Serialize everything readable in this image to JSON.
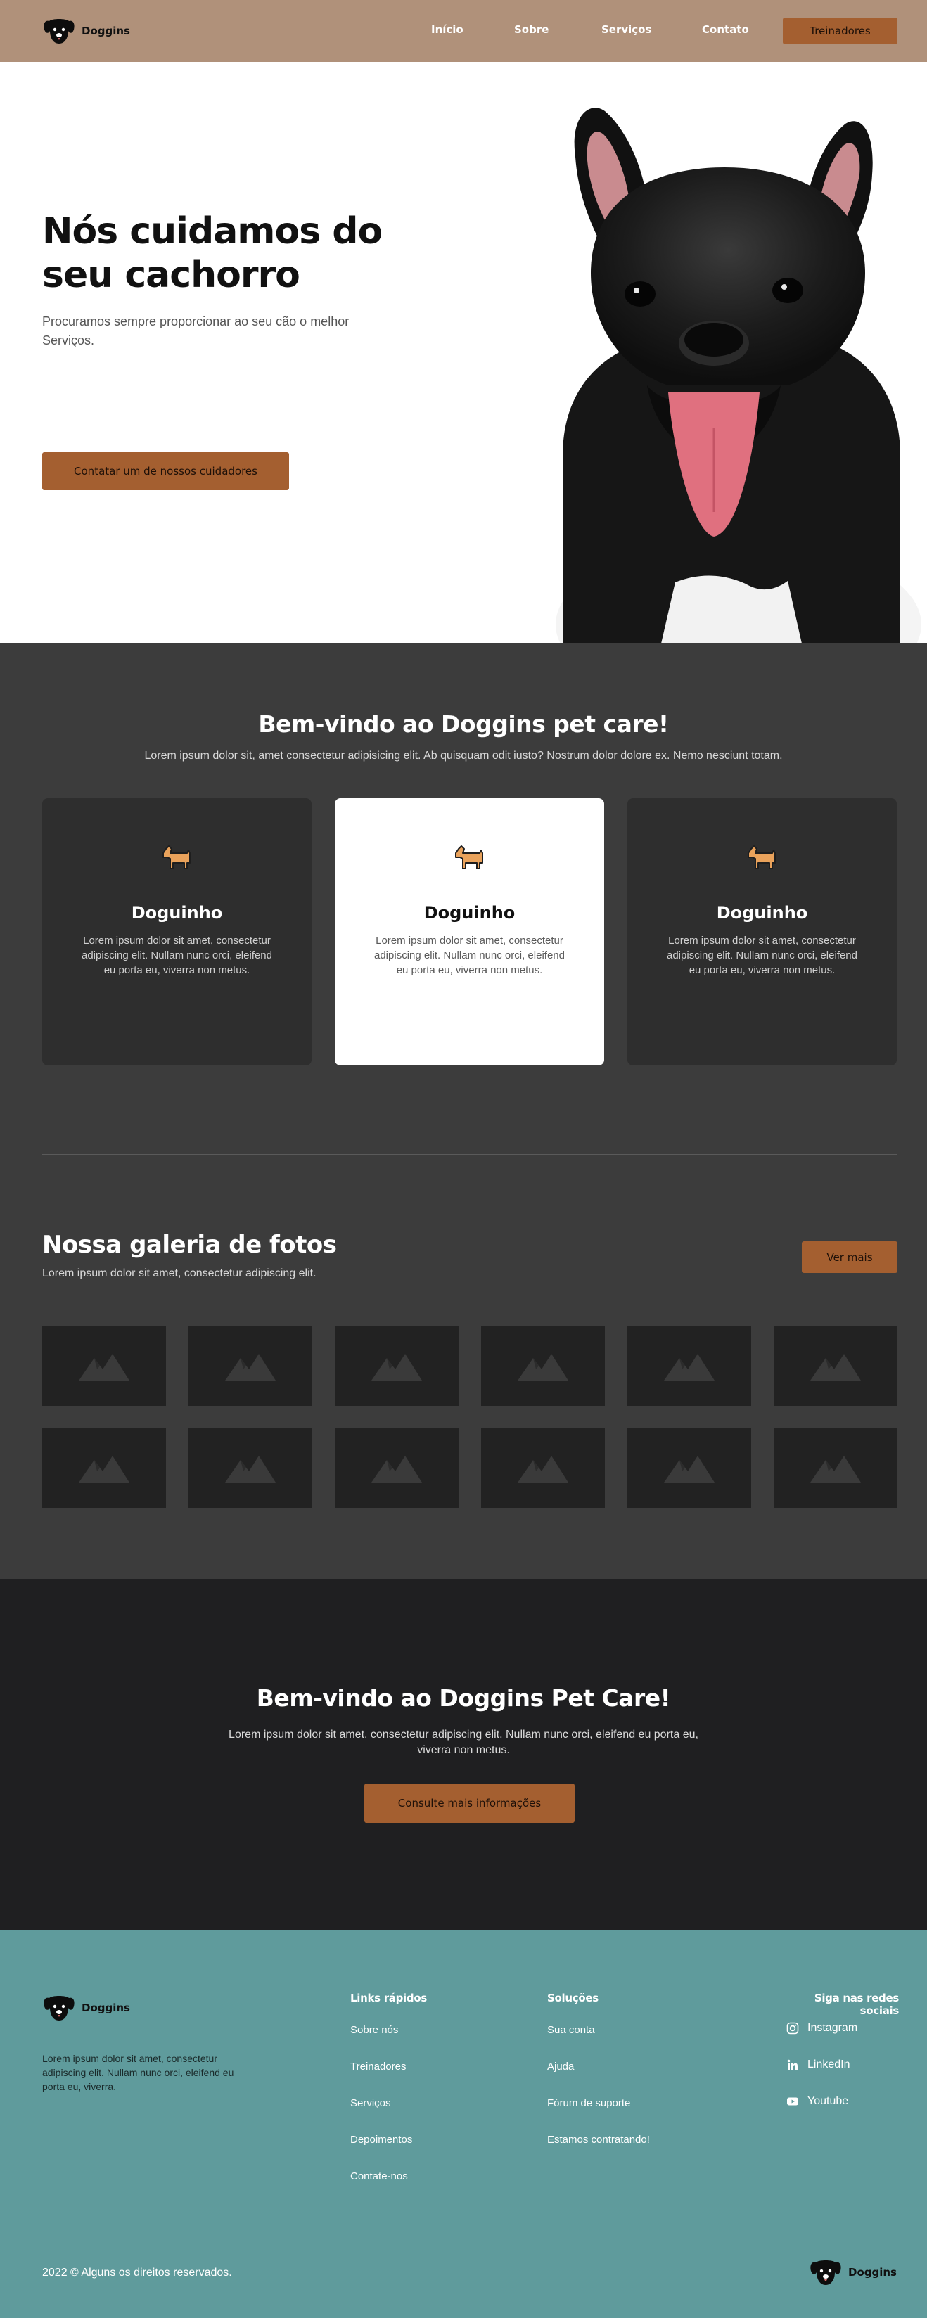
{
  "brand": {
    "name": "Doggins",
    "accent": "#a45f30",
    "nav_bg": "#b0917a",
    "footer_bg": "#5f9b9c"
  },
  "nav": {
    "links": [
      "Início",
      "Sobre",
      "Serviços",
      "Contato"
    ],
    "cta": "Treinadores"
  },
  "hero": {
    "title": "Nós cuidamos do seu cachorro",
    "subtitle": "Procuramos sempre proporcionar ao seu cão o melhor Serviços.",
    "button": "Contatar um de nossos cuidadores",
    "image": "french-bulldog-photo"
  },
  "welcome": {
    "title": "Bem-vindo ao Doggins pet care!",
    "subtitle": "Lorem ipsum dolor sit, amet consectetur adipisicing elit. Ab quisquam odit iusto? Nostrum dolor dolore ex. Nemo nesciunt totam.",
    "cards": [
      {
        "icon": "dog-icon",
        "title": "Doguinho",
        "text": "Lorem ipsum dolor sit amet, consectetur adipiscing elit. Nullam nunc orci, eleifend eu porta eu, viverra non metus.",
        "active": false
      },
      {
        "icon": "dog-icon",
        "title": "Doguinho",
        "text": "Lorem ipsum dolor sit amet, consectetur adipiscing elit. Nullam nunc orci, eleifend eu porta eu, viverra non metus.",
        "active": true
      },
      {
        "icon": "dog-icon",
        "title": "Doguinho",
        "text": "Lorem ipsum dolor sit amet, consectetur adipiscing elit. Nullam nunc orci, eleifend eu porta eu, viverra non metus.",
        "active": false
      }
    ]
  },
  "gallery": {
    "title": "Nossa galeria de fotos",
    "subtitle": "Lorem ipsum dolor sit amet, consectetur adipiscing elit.",
    "button": "Ver mais",
    "thumb_icon": "image-placeholder-icon"
  },
  "cta": {
    "title": "Bem-vindo ao Doggins Pet Care!",
    "text": "Lorem ipsum dolor sit amet, consectetur adipiscing elit. Nullam nunc orci, eleifend eu porta eu, viverra non metus.",
    "button": "Consulte mais informações"
  },
  "footer": {
    "description": "Lorem ipsum dolor sit amet, consectetur adipiscing elit. Nullam nunc orci, eleifend eu porta eu, viverra.",
    "quick_links": {
      "heading": "Links rápidos",
      "items": [
        "Sobre nós",
        "Treinadores",
        "Serviços",
        "Depoimentos",
        "Contate-nos"
      ]
    },
    "solutions": {
      "heading": "Soluções",
      "items": [
        "Sua conta",
        "Ajuda",
        "Fórum de suporte",
        "Estamos contratando!"
      ]
    },
    "social": {
      "heading": "Siga nas redes sociais",
      "items": [
        {
          "icon": "instagram-icon",
          "label": "Instagram"
        },
        {
          "icon": "linkedin-icon",
          "label": "LinkedIn"
        },
        {
          "icon": "youtube-icon",
          "label": "Youtube"
        }
      ]
    },
    "copyright": "2022 © Alguns os direitos reservados."
  }
}
